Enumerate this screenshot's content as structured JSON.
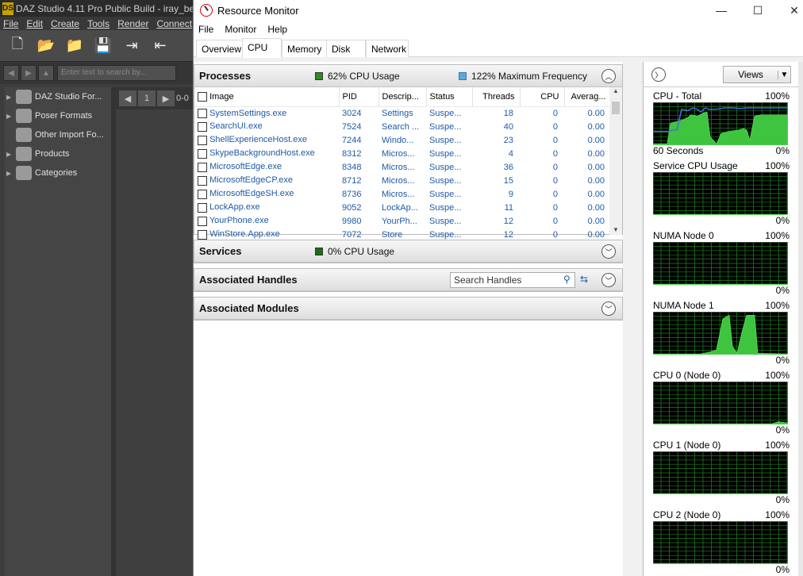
{
  "daz": {
    "title": "DAZ Studio 4.11 Pro Public Build - iray_be",
    "menu": [
      "File",
      "Edit",
      "Create",
      "Tools",
      "Render",
      "Connect"
    ],
    "search_placeholder": "Enter text to search by...",
    "tree": [
      "DAZ Studio For...",
      "Poser Formats",
      "Other Import Fo...",
      "Products",
      "Categories"
    ],
    "page_number": "1",
    "page_range": "0-0"
  },
  "window": {
    "title": "Resource Monitor",
    "controls": {
      "minimize": "—",
      "maximize": "☐",
      "close": "✕"
    }
  },
  "menubar": [
    "File",
    "Monitor",
    "Help"
  ],
  "tabs": [
    "Overview",
    "CPU",
    "Memory",
    "Disk",
    "Network"
  ],
  "active_tab": "CPU",
  "processes": {
    "title": "Processes",
    "cpu_usage": "62% CPU Usage",
    "max_freq": "122% Maximum Frequency",
    "cpu_usage_color": "#2e8b1f",
    "freq_color": "#5aa8e0",
    "columns": [
      "Image",
      "PID",
      "Descrip...",
      "Status",
      "Threads",
      "CPU",
      "Averag..."
    ],
    "rows": [
      [
        "SystemSettings.exe",
        "3024",
        "Settings",
        "Suspe...",
        "18",
        "0",
        "0.00"
      ],
      [
        "SearchUI.exe",
        "7524",
        "Search ...",
        "Suspe...",
        "40",
        "0",
        "0.00"
      ],
      [
        "ShellExperienceHost.exe",
        "7244",
        "Windo...",
        "Suspe...",
        "23",
        "0",
        "0.00"
      ],
      [
        "SkypeBackgroundHost.exe",
        "8312",
        "Micros...",
        "Suspe...",
        "4",
        "0",
        "0.00"
      ],
      [
        "MicrosoftEdge.exe",
        "8348",
        "Micros...",
        "Suspe...",
        "36",
        "0",
        "0.00"
      ],
      [
        "MicrosoftEdgeCP.exe",
        "8712",
        "Micros...",
        "Suspe...",
        "15",
        "0",
        "0.00"
      ],
      [
        "MicrosoftEdgeSH.exe",
        "8736",
        "Micros...",
        "Suspe...",
        "9",
        "0",
        "0.00"
      ],
      [
        "LockApp.exe",
        "9052",
        "LockAp...",
        "Suspe...",
        "11",
        "0",
        "0.00"
      ],
      [
        "YourPhone.exe",
        "9980",
        "YourPh...",
        "Suspe...",
        "12",
        "0",
        "0.00"
      ],
      [
        "WinStore.App.exe",
        "7072",
        "Store",
        "Suspe...",
        "12",
        "0",
        "0.00"
      ]
    ]
  },
  "services": {
    "title": "Services",
    "cpu_usage": "0% CPU Usage"
  },
  "handles": {
    "title": "Associated Handles",
    "search_placeholder": "Search Handles"
  },
  "modules": {
    "title": "Associated Modules"
  },
  "graphs_panel": {
    "views_label": "Views",
    "graphs": [
      {
        "title": "CPU - Total",
        "max": "100%",
        "min": "0%",
        "footer_left": "60 Seconds",
        "has_blue": true
      },
      {
        "title": "Service CPU Usage",
        "max": "100%",
        "min": "0%",
        "footer_left": ""
      },
      {
        "title": "NUMA Node 0",
        "max": "100%",
        "min": "0%",
        "footer_left": ""
      },
      {
        "title": "NUMA Node 1",
        "max": "100%",
        "min": "0%",
        "footer_left": ""
      },
      {
        "title": "CPU 0 (Node 0)",
        "max": "100%",
        "min": "0%",
        "footer_left": ""
      },
      {
        "title": "CPU 1 (Node 0)",
        "max": "100%",
        "min": "0%",
        "footer_left": ""
      },
      {
        "title": "CPU 2 (Node 0)",
        "max": "100%",
        "min": "0%",
        "footer_left": ""
      }
    ]
  }
}
